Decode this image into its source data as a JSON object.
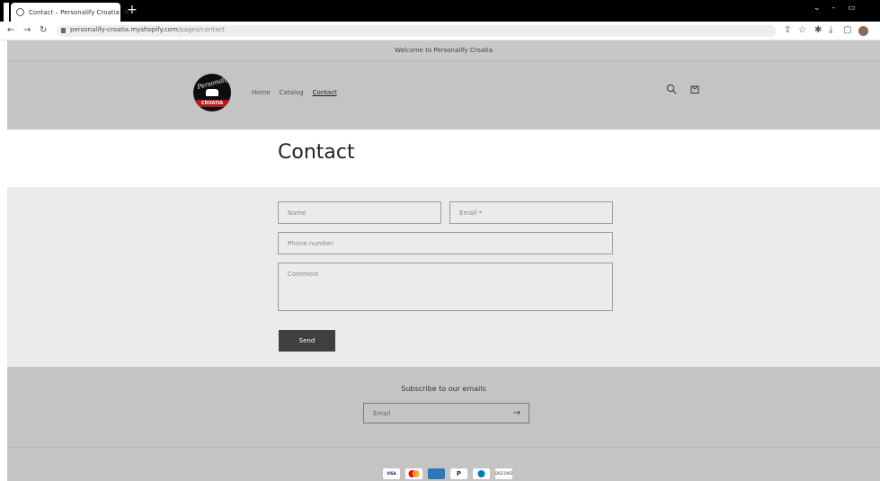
{
  "browser": {
    "tab_title": "Contact – Personalify Croatia",
    "tab_close": "×",
    "new_tab": "+",
    "url_host": "personalify-croatia.myshopify.com",
    "url_path": "/pages/contact"
  },
  "store": {
    "announcement": "Welcome to Personalify Croatia",
    "logo_script": "Personalify",
    "logo_banner": "CROATIA",
    "nav": [
      {
        "label": "Home"
      },
      {
        "label": "Catalog"
      },
      {
        "label": "Contact",
        "active": true
      }
    ]
  },
  "main": {
    "title": "Contact",
    "form": {
      "name_placeholder": "Name",
      "email_placeholder": "Email *",
      "phone_placeholder": "Phone number",
      "comment_placeholder": "Comment",
      "send_label": "Send"
    }
  },
  "footer": {
    "subscribe_title": "Subscribe to our emails",
    "email_placeholder": "Email",
    "arrow": "→",
    "payment_methods": [
      "VISA",
      "Mastercard",
      "American Express",
      "PayPal",
      "Diners Club",
      "DISCOVER"
    ]
  },
  "colors": {
    "header_bg": "#c4c4c4",
    "form_bg": "#ebebeb",
    "button_bg": "#3f3f3f"
  }
}
